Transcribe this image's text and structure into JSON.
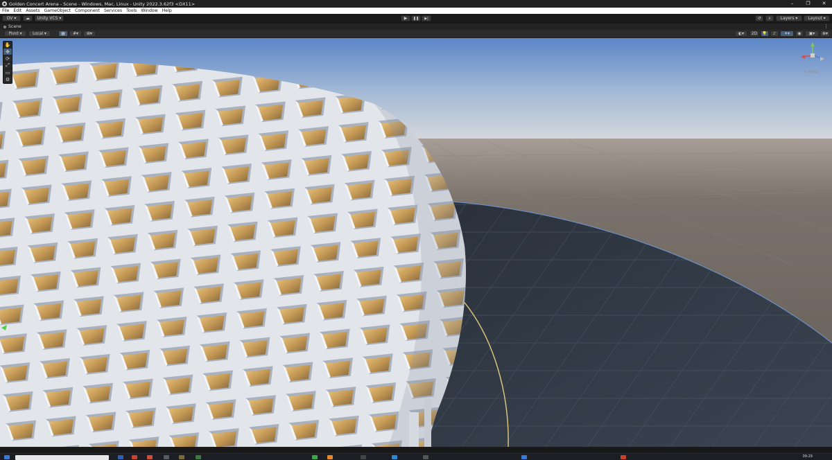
{
  "window": {
    "title": "Golden Concert Arena - Scene - Windows, Mac, Linux - Unity 2022.3.62f3 <DX11>",
    "minimize": "–",
    "maximize": "❐",
    "close": "✕"
  },
  "menu": [
    "File",
    "Edit",
    "Assets",
    "GameObject",
    "Component",
    "Services",
    "Tools",
    "Window",
    "Help"
  ],
  "toolbar": {
    "account": "OV",
    "cloud": "☁",
    "vcs": "Unity VCS",
    "play": "▶",
    "pause": "❚❚",
    "step": "▶|",
    "history": "↺",
    "search": "⌕",
    "layers": "Layers",
    "layout": "Layout"
  },
  "scene_tab": {
    "label": "Scene",
    "menu": "⋮"
  },
  "scene_toolbar": {
    "pivot": "Pivot",
    "local": "Local",
    "mode_2d": "2D"
  },
  "tools": [
    "✋",
    "✥",
    "⟳",
    "⤢",
    "▭",
    "⚙"
  ],
  "gizmo": {
    "label": "< Persp"
  },
  "taskbar": {
    "time": "09:29"
  },
  "colors": {
    "sky_top": "#5e88c9",
    "sky_horizon": "#cfd5dc",
    "ground": "#6e6761",
    "floor": "#2b3340",
    "stadium_frame": "#e4e7ec",
    "stadium_gold": "#c49c5c",
    "accent": "#46607c"
  }
}
